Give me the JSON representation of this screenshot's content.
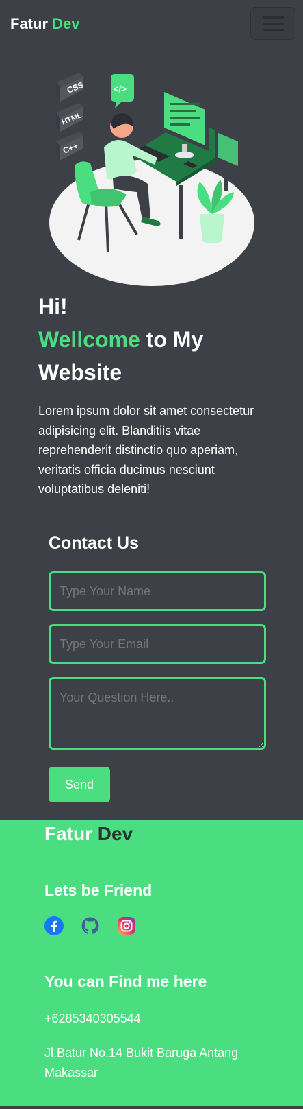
{
  "nav": {
    "brand_first": "Fatur",
    "brand_second": "Dev",
    "menu_icon": "hamburger-menu-icon"
  },
  "hero": {
    "illustration_labels": [
      "CSS",
      "HTML",
      "C++",
      "</>"
    ],
    "greeting": "Hi!",
    "welcome_accent": "Wellcome",
    "welcome_rest": " to My Website",
    "paragraph": "Lorem ipsum dolor sit amet consectetur adipisicing elit. Blanditiis vitae reprehenderit distinctio quo aperiam, veritatis officia ducimus nesciunt voluptatibus deleniti!"
  },
  "contact": {
    "title": "Contact Us",
    "name_placeholder": "Type Your Name",
    "email_placeholder": "Type Your Email",
    "question_placeholder": "Your Question Here..",
    "send_label": "Send"
  },
  "footer": {
    "brand_first": "Fatur",
    "brand_second": "Dev",
    "friend_title": "Lets be Friend",
    "socials": [
      "facebook-icon",
      "github-icon",
      "instagram-icon"
    ],
    "find_title": "You can Find me here",
    "phone": "+6285340305544",
    "address": "Jl.Batur No.14 Bukit Baruga Antang Makassar"
  },
  "colors": {
    "background": "#3e4047",
    "accent": "#4ade80",
    "dark_text": "#2f3136"
  }
}
